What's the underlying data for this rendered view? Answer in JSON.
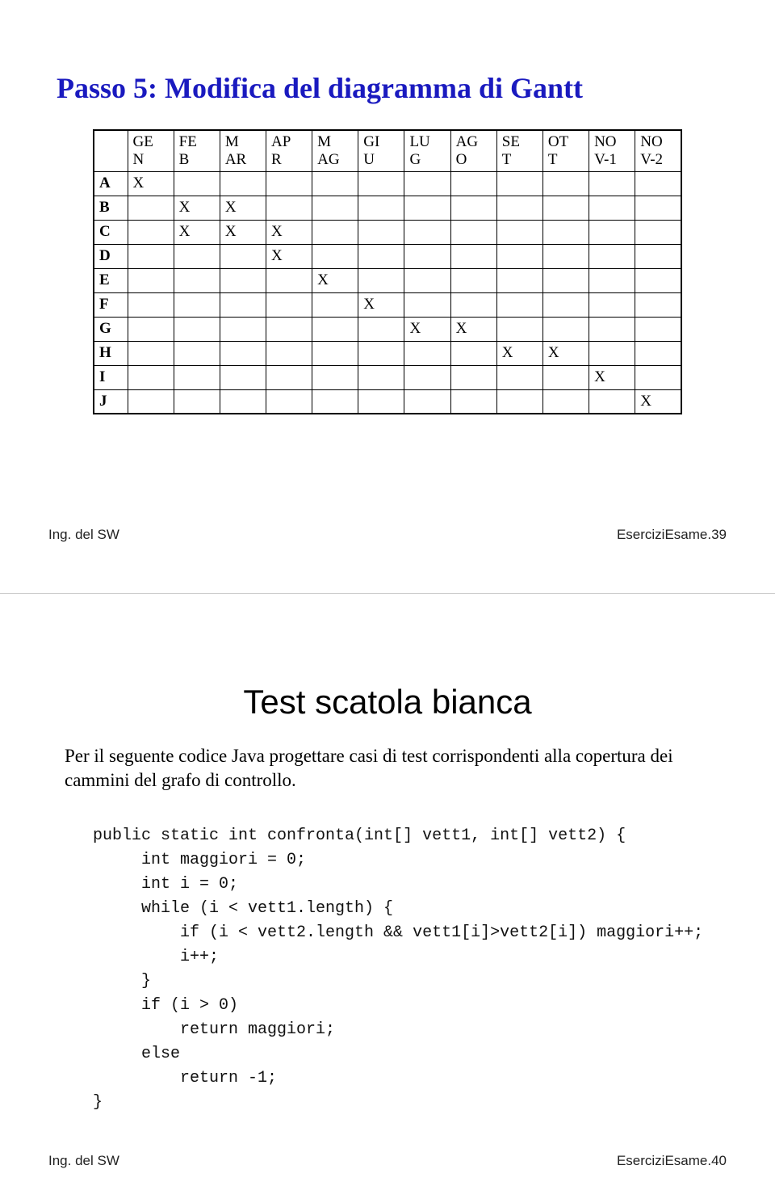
{
  "slide1": {
    "title": "Passo 5: Modifica del diagramma di Gantt",
    "footer_left": "Ing. del SW",
    "footer_right": "EserciziEsame.39"
  },
  "slide2": {
    "title": "Test scatola bianca",
    "body": "Per il seguente codice Java progettare casi di test corrispondenti alla copertura dei cammini del grafo di controllo.",
    "code": "public static int confronta(int[] vett1, int[] vett2) {\n     int maggiori = 0;\n     int i = 0;\n     while (i < vett1.length) {\n         if (i < vett2.length && vett1[i]>vett2[i]) maggiori++;\n         i++;\n     }\n     if (i > 0)\n         return maggiori;\n     else\n         return -1;\n}",
    "footer_left": "Ing. del SW",
    "footer_right": "EserciziEsame.40"
  },
  "chart_data": {
    "type": "table",
    "title": "Passo 5: Modifica del diagramma di Gantt",
    "columns": [
      "GE N",
      "FE B",
      "M AR",
      "AP R",
      "M AG",
      "GI U",
      "LU G",
      "AG O",
      "SE T",
      "OT T",
      "NO V-1",
      "NO V-2"
    ],
    "rows": [
      {
        "label": "A",
        "cells": [
          "X",
          "",
          "",
          "",
          "",
          "",
          "",
          "",
          "",
          "",
          "",
          ""
        ]
      },
      {
        "label": "B",
        "cells": [
          "",
          "X",
          "X",
          "",
          "",
          "",
          "",
          "",
          "",
          "",
          "",
          ""
        ]
      },
      {
        "label": "C",
        "cells": [
          "",
          "X",
          "X",
          "X",
          "",
          "",
          "",
          "",
          "",
          "",
          "",
          ""
        ]
      },
      {
        "label": "D",
        "cells": [
          "",
          "",
          "",
          "X",
          "",
          "",
          "",
          "",
          "",
          "",
          "",
          ""
        ]
      },
      {
        "label": "E",
        "cells": [
          "",
          "",
          "",
          "",
          "X",
          "",
          "",
          "",
          "",
          "",
          "",
          ""
        ]
      },
      {
        "label": "F",
        "cells": [
          "",
          "",
          "",
          "",
          "",
          "X",
          "",
          "",
          "",
          "",
          "",
          ""
        ]
      },
      {
        "label": "G",
        "cells": [
          "",
          "",
          "",
          "",
          "",
          "",
          "X",
          "X",
          "",
          "",
          "",
          ""
        ]
      },
      {
        "label": "H",
        "cells": [
          "",
          "",
          "",
          "",
          "",
          "",
          "",
          "",
          "X",
          "X",
          "",
          ""
        ]
      },
      {
        "label": "I",
        "cells": [
          "",
          "",
          "",
          "",
          "",
          "",
          "",
          "",
          "",
          "",
          "X",
          ""
        ]
      },
      {
        "label": "J",
        "cells": [
          "",
          "",
          "",
          "",
          "",
          "",
          "",
          "",
          "",
          "",
          "",
          "X"
        ]
      }
    ]
  }
}
